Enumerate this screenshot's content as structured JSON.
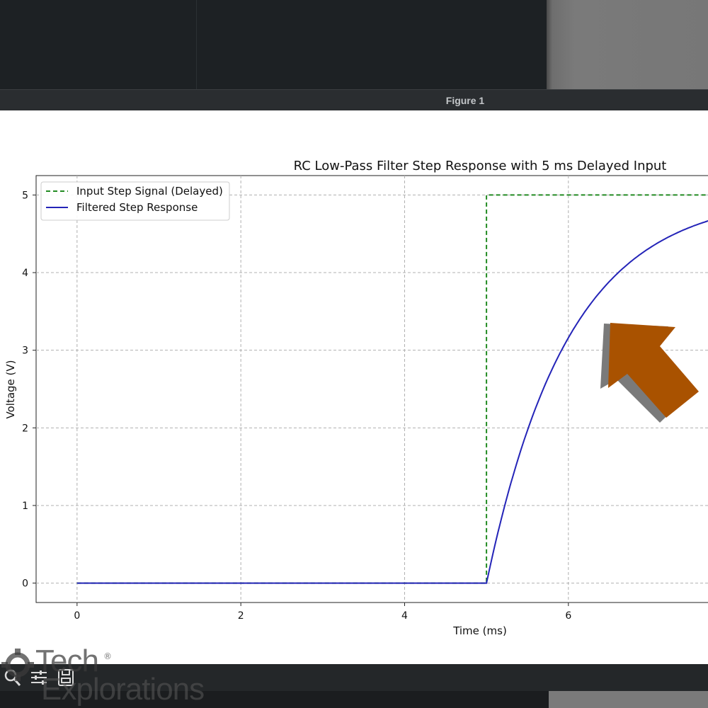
{
  "window": {
    "title": "Figure 1"
  },
  "chart_data": {
    "type": "line",
    "title": "RC Low-Pass Filter Step Response with 5 ms Delayed Input",
    "xlabel": "Time (ms)",
    "ylabel": "Voltage (V)",
    "xlim": [
      -0.5,
      7.8
    ],
    "ylim": [
      -0.25,
      5.25
    ],
    "xticks": [
      "0",
      "2",
      "4",
      "6"
    ],
    "yticks": [
      "0",
      "1",
      "2",
      "3",
      "4",
      "5"
    ],
    "grid": true,
    "legend_position": "upper-left",
    "series": [
      {
        "name": "Input Step Signal (Delayed)",
        "style": "dashed",
        "color": "#228b22",
        "x": [
          0,
          5,
          5,
          7.8
        ],
        "y": [
          0,
          0,
          5,
          5
        ]
      },
      {
        "name": "Filtered Step Response",
        "style": "solid",
        "color": "#2424b8",
        "x": [
          0,
          5,
          5.25,
          5.5,
          5.75,
          6,
          6.25,
          6.5,
          6.75,
          7,
          7.25,
          7.5,
          7.8
        ],
        "y": [
          0,
          0,
          1.0,
          1.81,
          2.46,
          2.98,
          3.39,
          3.72,
          3.99,
          4.2,
          4.38,
          4.51,
          4.64
        ]
      }
    ]
  },
  "overlay": {
    "arrow_color": "#a95200",
    "arrow_shadow_color": "#7a7a7a"
  },
  "toolbar": {
    "icons": [
      "zoom-icon",
      "configure-subplots-icon",
      "save-icon"
    ]
  },
  "watermark": {
    "line1": "Tech",
    "line2": "Explorations",
    "mark": "®"
  }
}
